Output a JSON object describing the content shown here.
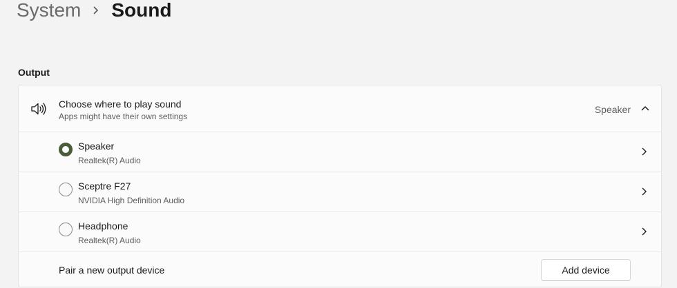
{
  "breadcrumb": {
    "parent": "System",
    "separator_icon": "chevron-right-icon",
    "current": "Sound"
  },
  "output": {
    "section_title": "Output",
    "header": {
      "icon": "speaker-icon",
      "title": "Choose where to play sound",
      "subtitle": "Apps might have their own settings",
      "selected_value": "Speaker",
      "expand_icon": "chevron-up-icon"
    },
    "devices": [
      {
        "name": "Speaker",
        "driver": "Realtek(R) Audio",
        "selected": true
      },
      {
        "name": "Sceptre F27",
        "driver": "NVIDIA High Definition Audio",
        "selected": false
      },
      {
        "name": "Headphone",
        "driver": "Realtek(R) Audio",
        "selected": false
      }
    ],
    "pair": {
      "label": "Pair a new output device",
      "button_label": "Add device"
    }
  },
  "colors": {
    "background": "#f3f3f3",
    "card": "#fbfbfb",
    "radio_selected": "#4a5d3a"
  }
}
